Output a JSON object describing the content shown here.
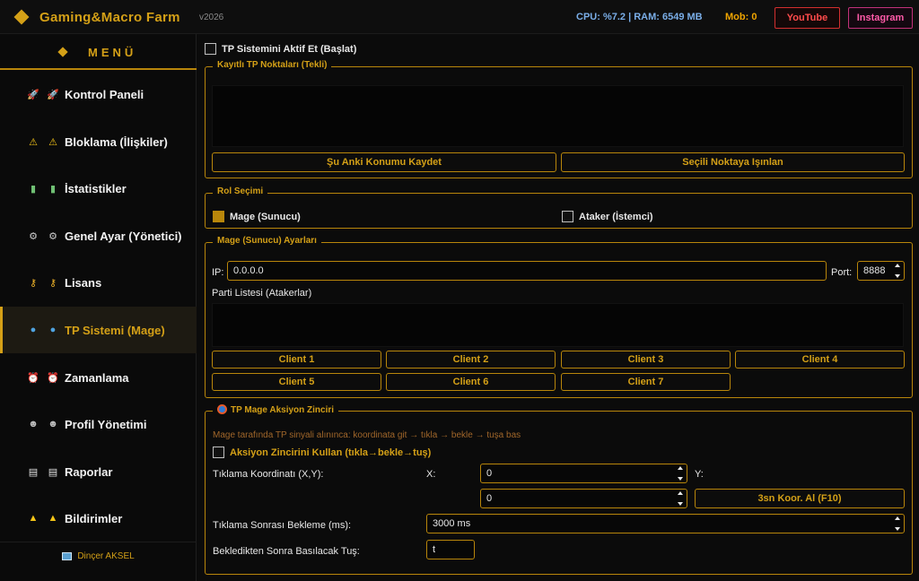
{
  "app": {
    "title": "Gaming&Macro Farm",
    "version": "v2026",
    "sysinfo": "CPU: %7.2 | RAM: 6549 MB",
    "mob": "Mob: 0",
    "youtube_label": "YouTube",
    "instagram_label": "Instagram"
  },
  "sidebar": {
    "menu_title": "MENÜ",
    "items": [
      {
        "label": "Kontrol Paneli",
        "icon": "rocket-icon"
      },
      {
        "label": "Bloklama (İlişkiler)",
        "icon": "warning-icon"
      },
      {
        "label": "İstatistikler",
        "icon": "chart-icon"
      },
      {
        "label": "Genel Ayar (Yönetici)",
        "icon": "gear-icon"
      },
      {
        "label": "Lisans",
        "icon": "key-icon"
      },
      {
        "label": "TP Sistemi (Mage)",
        "icon": "globe-icon",
        "active": true
      },
      {
        "label": "Zamanlama",
        "icon": "alarm-clock-icon"
      },
      {
        "label": "Profil Yönetimi",
        "icon": "user-icon"
      },
      {
        "label": "Raporlar",
        "icon": "clipboard-icon"
      },
      {
        "label": "Bildirimler",
        "icon": "bell-icon"
      }
    ],
    "footer": "Dinçer AKSEL"
  },
  "main": {
    "tp_enable_label": "TP Sistemini Aktif Et (Başlat)",
    "saved_points": {
      "title": "Kayıtlı TP Noktaları (Tekli)",
      "save_button": "Şu Anki Konumu Kaydet",
      "teleport_button": "Seçili Noktaya Işınlan"
    },
    "role": {
      "title": "Rol Seçimi",
      "mage_label": "Mage (Sunucu)",
      "attacker_label": "Ataker (İstemci)",
      "selected": "Mage (Sunucu)"
    },
    "mage_settings": {
      "title": "Mage (Sunucu) Ayarları",
      "ip_label": "IP:",
      "ip_value": "0.0.0.0",
      "port_label": "Port:",
      "port_value": "8888",
      "party_label": "Parti Listesi (Atakerlar)",
      "clients": [
        "Client 1",
        "Client 2",
        "Client 3",
        "Client 4",
        "Client 5",
        "Client 6",
        "Client 7"
      ]
    },
    "action_chain": {
      "title": "TP Mage Aksiyon Zinciri",
      "hint": "Mage tarafında TP sinyali alınınca: koordinata git → tıkla → bekle → tuşa bas",
      "use_label": "Aksiyon Zincirini Kullan (tıkla→bekle→tuş)",
      "coord_label": "Tıklama Koordinatı (X,Y):",
      "x_label": "X:",
      "x_value": "0",
      "y_label": "Y:",
      "y_value": "0",
      "capture_button": "3sn Koor. Al (F10)",
      "wait_label": "Tıklama Sonrası Bekleme (ms):",
      "wait_value": "3000 ms",
      "key_label": "Bekledikten Sonra Basılacak Tuş:",
      "key_value": "t"
    }
  }
}
